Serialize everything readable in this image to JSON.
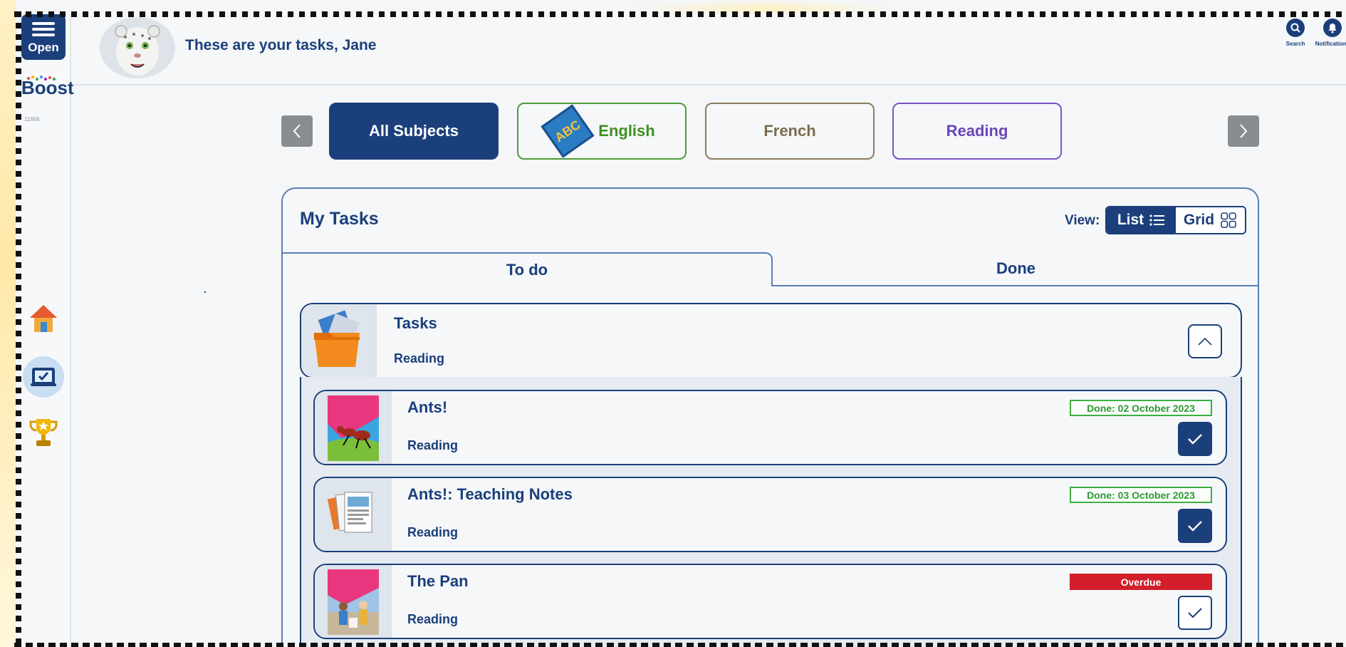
{
  "menu": {
    "label": "Open"
  },
  "brand": {
    "name": "Boost",
    "sub": "11666"
  },
  "header": {
    "greeting": "These are your tasks, Jane",
    "search_label": "Search",
    "notifications_label": "Notifications"
  },
  "subjects": [
    {
      "label": "All Subjects",
      "selected": true
    },
    {
      "label": "English",
      "icon_text": "ABC"
    },
    {
      "label": "French"
    },
    {
      "label": "Reading"
    }
  ],
  "panel": {
    "title": "My Tasks",
    "view_label": "View:",
    "view_list": "List",
    "view_grid": "Grid",
    "tabs": {
      "todo": "To do",
      "done": "Done"
    }
  },
  "group": {
    "title": "Tasks",
    "subject": "Reading"
  },
  "tasks": [
    {
      "title": "Ants!",
      "subject": "Reading",
      "status": "Done: 02 October 2023",
      "checked": true
    },
    {
      "title": "Ants!: Teaching Notes",
      "subject": "Reading",
      "status": "Done: 03 October 2023",
      "checked": true
    },
    {
      "title": "The Pan",
      "subject": "Reading",
      "status": "Overdue",
      "checked": false
    }
  ],
  "colors": {
    "primary": "#1b3f7a",
    "english": "#3f8f22",
    "french": "#7a6b4d",
    "reading": "#6b45b8",
    "done_badge": "#2c9a33",
    "overdue_badge": "#d21f2b"
  }
}
